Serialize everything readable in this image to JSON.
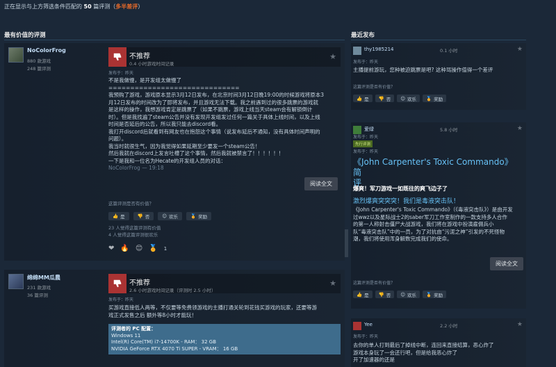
{
  "filter": {
    "prefix": "正在显示与上方筛选条件匹配的 ",
    "count": "50",
    "suffix": " 篇评测（",
    "sentiment": "多半差评",
    "close": "）"
  },
  "sections": {
    "helpful": "最有价值的评测",
    "recent": "最近发布"
  },
  "common": {
    "helpful_q": "这篇评测是否有价值？",
    "yes": "是",
    "no": "否",
    "funny": "欢乐",
    "award": "奖励",
    "read_more": "阅读全文",
    "not_recommended": "不推荐",
    "posted_yesterday": "发布于：昨天"
  },
  "reviews": [
    {
      "author": "NoColorFrog",
      "games": "880 款游戏",
      "reviews": "248 篇评测",
      "hours": "0.4 小时游戏时间记录",
      "lines": [
        "不是我做慢，是开发组太做慢了",
        "==============================",
        "我预购了游戏，游戏原本显示3月12日发布，在北京时间3月12日晚19:00的时候游戏将原本3",
        "月12日发布的时间改为了即将发布，并且游戏无法下载。我之前遇到过的很多跳票的游戏就",
        "是这样的操作，我想游戏肯定是跳票了（如果不跳票，游戏上线当天steam会有解锁倒计",
        "时）。但是我找遍了steam公告并没有发现开发组发过任何一篇关于具体上线时间，以及上线",
        "时间是否延后的公告，所以我只能去discord看。",
        "我打开discord后就看到有网友也在抱怨这个事情（说发布延后不通知，没有具体时间声明的",
        "问题）。",
        "我当时就很生气，因为我觉得如果延期至少要发一个steam公告！",
        "然后我就在discord上发言吐槽了这个事情，然后我就被禁言了！！！！！！",
        "一下是我和一位名为Hecate的开发组人员的对话："
      ],
      "fade_line": "NoColorFrog — 19:18",
      "votes_helpful": "23 人觉得这篇评测有价值",
      "votes_funny": "4 人觉得这篇评测很欢乐",
      "award_count": "1"
    },
    {
      "author": "绵绵MM瓜農",
      "games": "231 款游戏",
      "reviews": "36 篇评测",
      "hours": "2.6 小时游戏时间记录（评测时 2.5 小时）",
      "lines": [
        "买游戏直接低人两等，不仅要等免费领游戏的主播打通关轮到花钱买游戏的玩家，还要等游",
        "戏正式发售之后 额外等8小时才能玩！"
      ],
      "specs_title": "评测者的 PC 配置：",
      "specs": [
        "Windows 11",
        "Intel(R) Core(TM) i7-14700K - RAM： 32 GB",
        "NVIDIA GeForce RTX 4070 Ti SUPER - VRAM： 16 GB"
      ]
    }
  ],
  "recent": [
    {
      "name": "thy1985214",
      "hours": "0.1 小时",
      "text": "主播提前游玩，您种被迫跳票是吧? 这种骂操作值得一个差评"
    },
    {
      "name": "爱绿",
      "hours": "5.8 小时",
      "badge": "先行评测",
      "title_line1": "《John Carpenter's Toxic Commando》简",
      "title_line2": "评",
      "headline": "爆爽！军刀游戏一如既往的爽飞边子了",
      "blue_line": "激烈爆爽突突突！我们是毒液突击队！",
      "lines": [
        "《John Carpenter's Toxic Commando》（《毒液突击队》）是由开发",
        "过wwz以及星际战士2的saber军刀工作室制作的一款支持多人合作",
        "的第一人称射击僵尸大战游戏，我们将在游戏中扮演雇佣兵小",
        "队“毒液突击队”中的一员，为了对抗由“污泥之神”引发的不死怪物",
        "潮，我们将使用浑身解数完成我们的使命。"
      ]
    },
    {
      "name": "Yee",
      "hours": "2.2 小时",
      "lines": [
        "去你的单人打到最后了掉线中断，连回来直接结算，恶心炸了",
        "游戏本身玩了一会还行吧，但是给我恶心炸了",
        "开了加速器的还是"
      ]
    }
  ],
  "colors": {
    "background": "#1b2838",
    "accent": "#67c1f5",
    "negative": "#e4692a"
  }
}
